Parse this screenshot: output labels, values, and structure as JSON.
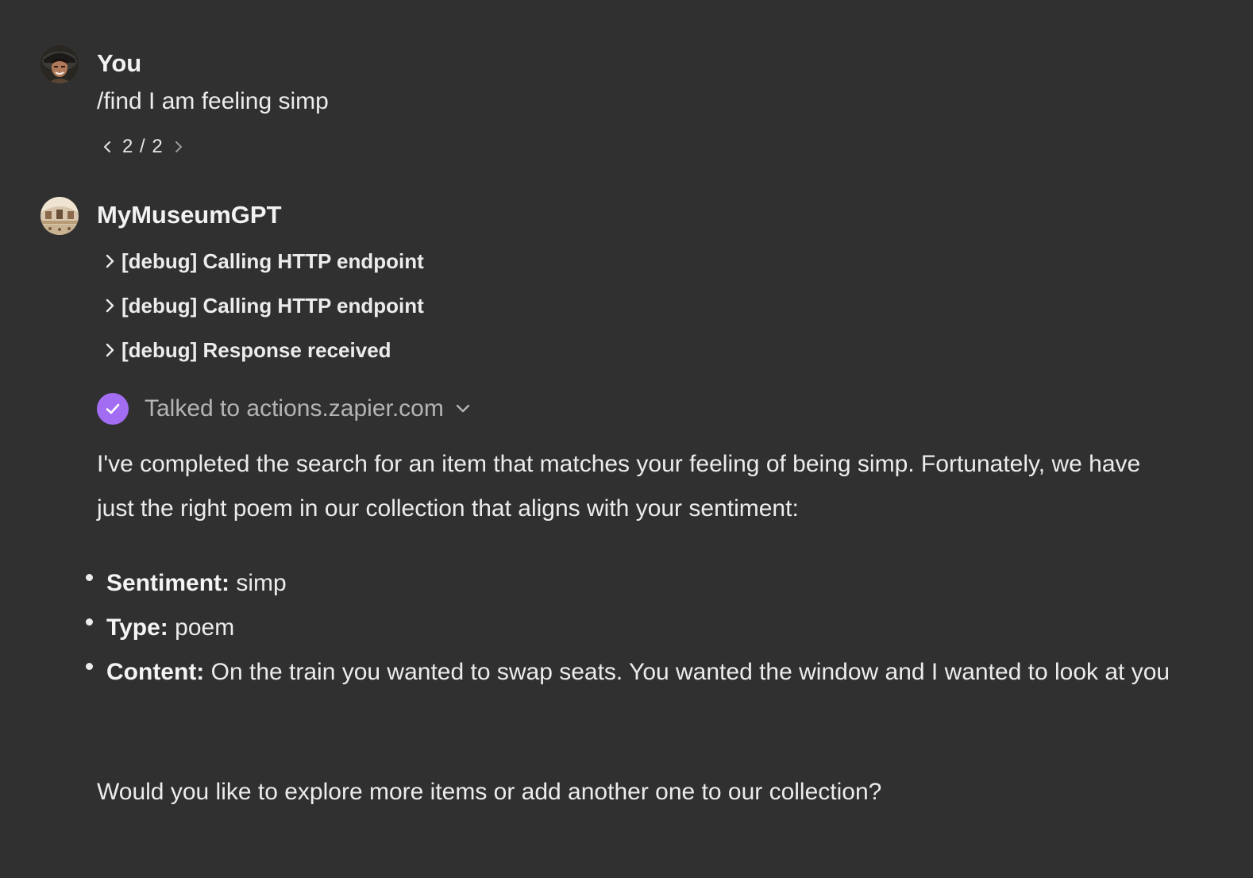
{
  "user_message": {
    "author": "You",
    "avatar_icon": "user-avatar",
    "text": "/find I am feeling simp",
    "pager": {
      "current": "2",
      "total": "2",
      "label": "2 / 2"
    }
  },
  "assistant_message": {
    "author": "MyMuseumGPT",
    "avatar_icon": "museum-avatar",
    "debug_items": [
      {
        "label": "[debug] Calling HTTP endpoint"
      },
      {
        "label": "[debug] Calling HTTP endpoint"
      },
      {
        "label": "[debug] Response received"
      }
    ],
    "action": {
      "label": "Talked to actions.zapier.com",
      "status_icon": "check-circle-icon",
      "accent_color": "#a26cf3"
    },
    "intro": "I've completed the search for an item that matches your feeling of being simp. Fortunately, we have just the right poem in our collection that aligns with your sentiment:",
    "bullets": [
      {
        "key": "Sentiment:",
        "value": "simp"
      },
      {
        "key": "Type:",
        "value": "poem"
      },
      {
        "key": "Content:",
        "value": "On the train you wanted to swap seats. You wanted the window and I wanted to look at you"
      }
    ],
    "outro": "Would you like to explore more items or add another one to our collection?"
  }
}
